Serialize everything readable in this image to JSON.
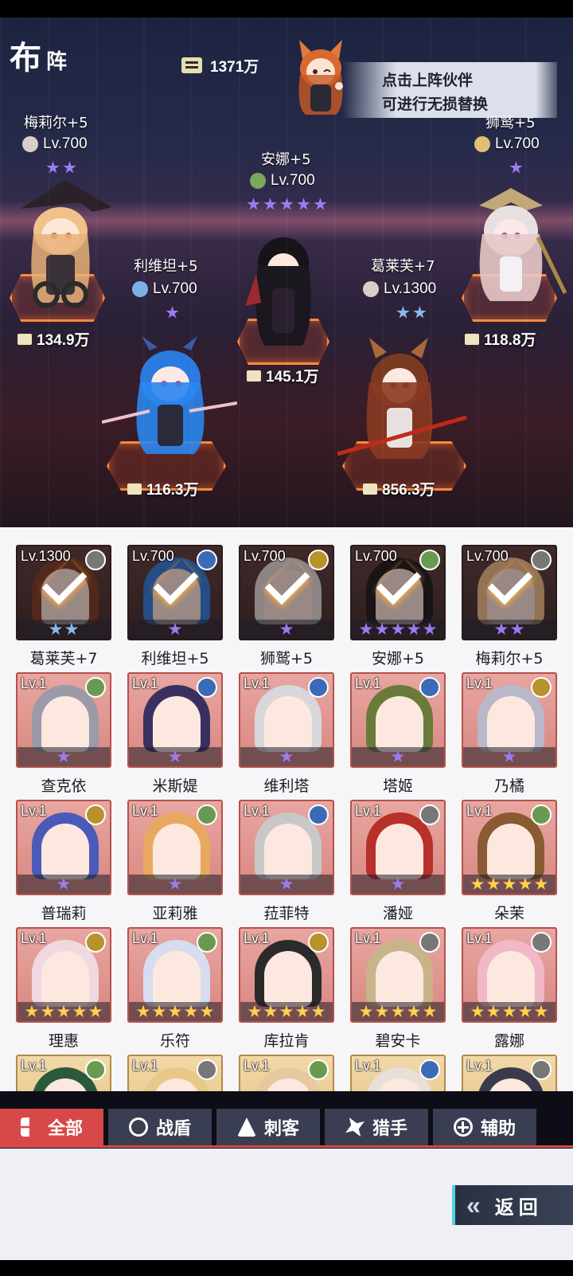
{
  "header": {
    "title_main": "布",
    "title_sub": "阵",
    "total_power": "1371万",
    "hint_line1": "点击上阵伙伴",
    "hint_line2": "可进行无损替换"
  },
  "lineup": [
    {
      "name": "梅莉尔+5",
      "level": "Lv.700",
      "stars": 2,
      "star_color": "purple",
      "power": "134.9万",
      "role_icon": "assassin-icon"
    },
    {
      "name": "利维坦+5",
      "level": "Lv.700",
      "stars": 1,
      "star_color": "purple",
      "power": "116.3万",
      "role_icon": "tank-icon"
    },
    {
      "name": "安娜+5",
      "level": "Lv.700",
      "stars": 5,
      "star_color": "purple",
      "power": "145.1万",
      "role_icon": "support-icon"
    },
    {
      "name": "葛莱芙+7",
      "level": "Lv.1300",
      "stars": 2,
      "star_color": "blue",
      "power": "856.3万",
      "role_icon": "assassin-icon"
    },
    {
      "name": "狮鹫+5",
      "level": "Lv.700",
      "stars": 1,
      "star_color": "purple",
      "power": "118.8万",
      "role_icon": "hunter-icon"
    }
  ],
  "roster_rows": [
    [
      {
        "name": "葛莱芙+7",
        "level": "Lv.1300",
        "bg": "dark",
        "role": "gray",
        "checked": true,
        "stars": 2,
        "star_color": "blue"
      },
      {
        "name": "利维坦+5",
        "level": "Lv.700",
        "bg": "dark",
        "role": "blue",
        "checked": true,
        "stars": 1,
        "star_color": "purple"
      },
      {
        "name": "狮鹫+5",
        "level": "Lv.700",
        "bg": "dark",
        "role": "gold",
        "checked": true,
        "stars": 1,
        "star_color": "purple"
      },
      {
        "name": "安娜+5",
        "level": "Lv.700",
        "bg": "dark",
        "role": "green",
        "checked": true,
        "stars": 5,
        "star_color": "purple"
      },
      {
        "name": "梅莉尔+5",
        "level": "Lv.700",
        "bg": "dark",
        "role": "gray",
        "checked": true,
        "stars": 2,
        "star_color": "purple"
      }
    ],
    [
      {
        "name": "查克依",
        "level": "Lv.1",
        "bg": "red",
        "role": "green",
        "checked": false,
        "stars": 1,
        "star_color": "purple"
      },
      {
        "name": "米斯媞",
        "level": "Lv.1",
        "bg": "red",
        "role": "blue",
        "checked": false,
        "stars": 1,
        "star_color": "purple"
      },
      {
        "name": "维利塔",
        "level": "Lv.1",
        "bg": "red",
        "role": "blue",
        "checked": false,
        "stars": 1,
        "star_color": "purple"
      },
      {
        "name": "塔姬",
        "level": "Lv.1",
        "bg": "red",
        "role": "blue",
        "checked": false,
        "stars": 1,
        "star_color": "purple"
      },
      {
        "name": "乃橘",
        "level": "Lv.1",
        "bg": "red",
        "role": "gold",
        "checked": false,
        "stars": 1,
        "star_color": "purple"
      }
    ],
    [
      {
        "name": "普瑞莉",
        "level": "Lv.1",
        "bg": "red",
        "role": "gold",
        "checked": false,
        "stars": 1,
        "star_color": "purple"
      },
      {
        "name": "亚莉雅",
        "level": "Lv.1",
        "bg": "red",
        "role": "green",
        "checked": false,
        "stars": 1,
        "star_color": "purple"
      },
      {
        "name": "菈菲特",
        "level": "Lv.1",
        "bg": "red",
        "role": "blue",
        "checked": false,
        "stars": 1,
        "star_color": "purple"
      },
      {
        "name": "潘娅",
        "level": "Lv.1",
        "bg": "red",
        "role": "gray",
        "checked": false,
        "stars": 1,
        "star_color": "purple"
      },
      {
        "name": "朵茉",
        "level": "Lv.1",
        "bg": "red",
        "role": "green",
        "checked": false,
        "stars": 5,
        "star_color": "gold"
      }
    ],
    [
      {
        "name": "理惠",
        "level": "Lv.1",
        "bg": "red",
        "role": "gold",
        "checked": false,
        "stars": 5,
        "star_color": "gold"
      },
      {
        "name": "乐符",
        "level": "Lv.1",
        "bg": "red",
        "role": "green",
        "checked": false,
        "stars": 5,
        "star_color": "gold"
      },
      {
        "name": "库拉肯",
        "level": "Lv.1",
        "bg": "red",
        "role": "gold",
        "checked": false,
        "stars": 5,
        "star_color": "gold"
      },
      {
        "name": "碧安卡",
        "level": "Lv.1",
        "bg": "red",
        "role": "gray",
        "checked": false,
        "stars": 5,
        "star_color": "gold"
      },
      {
        "name": "露娜",
        "level": "Lv.1",
        "bg": "red",
        "role": "gray",
        "checked": false,
        "stars": 5,
        "star_color": "gold"
      }
    ],
    [
      {
        "name": "",
        "level": "Lv.1",
        "bg": "tan",
        "role": "green",
        "checked": false,
        "stars": 0,
        "star_color": "gold"
      },
      {
        "name": "",
        "level": "Lv.1",
        "bg": "tan",
        "role": "gray",
        "checked": false,
        "stars": 0,
        "star_color": "gold"
      },
      {
        "name": "",
        "level": "Lv.1",
        "bg": "tan",
        "role": "green",
        "checked": false,
        "stars": 0,
        "star_color": "gold"
      },
      {
        "name": "",
        "level": "Lv.1",
        "bg": "tan",
        "role": "blue",
        "checked": false,
        "stars": 0,
        "star_color": "gold"
      },
      {
        "name": "",
        "level": "Lv.1",
        "bg": "tan",
        "role": "gray",
        "checked": false,
        "stars": 0,
        "star_color": "gold"
      }
    ]
  ],
  "tabs": [
    {
      "label": "全部",
      "icon": "grid-icon",
      "active": true
    },
    {
      "label": "战盾",
      "icon": "shield-icon",
      "active": false
    },
    {
      "label": "刺客",
      "icon": "dagger-icon",
      "active": false
    },
    {
      "label": "猎手",
      "icon": "claw-icon",
      "active": false
    },
    {
      "label": "辅助",
      "icon": "cross-icon",
      "active": false
    }
  ],
  "back_button": {
    "label": "返回"
  },
  "colors": {
    "accent": "#d94848",
    "tab_bg": "#3a3e52",
    "pad_glow": "#ff8a3a",
    "back_edge": "#4fd1e0"
  }
}
